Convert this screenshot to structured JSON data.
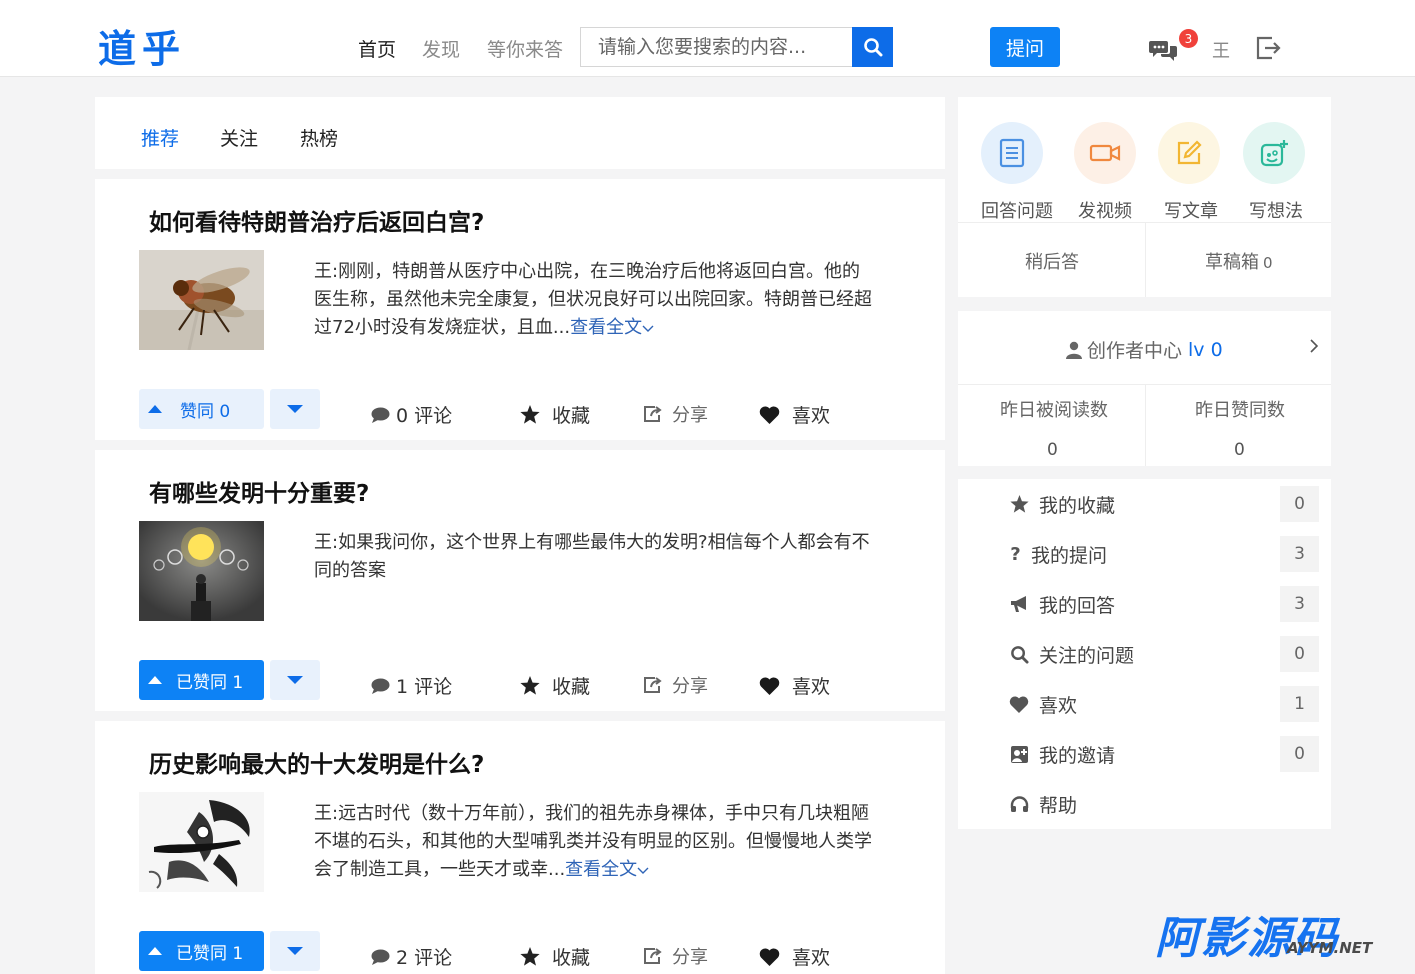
{
  "header": {
    "logo": "道乎",
    "nav": [
      "首页",
      "发现",
      "等你来答"
    ],
    "search_placeholder": "请输入您要搜索的内容...",
    "ask_label": "提问",
    "message_badge": "3",
    "user_name": "王"
  },
  "feed_tabs": [
    "推荐",
    "关注",
    "热榜"
  ],
  "posts": [
    {
      "title": "如何看待特朗普治疗后返回白宫?",
      "excerpt": "王:刚刚，特朗普从医疗中心出院，在三晚治疗后他将返回白宫。他的医生称，虽然他未完全康复，但状况良好可以出院回家。特朗普已经超过72小时没有发烧症状，且血...",
      "more": "查看全文",
      "vote_label": "赞同 0",
      "comments": "0 评论",
      "favorite": "收藏",
      "share": "分享",
      "like": "喜欢"
    },
    {
      "title": "有哪些发明十分重要?",
      "excerpt": "王:如果我问你，这个世界上有哪些最伟大的发明?相信每个人都会有不同的答案",
      "more": "",
      "vote_label": "已赞同 1",
      "comments": "1 评论",
      "favorite": "收藏",
      "share": "分享",
      "like": "喜欢"
    },
    {
      "title": "历史影响最大的十大发明是什么?",
      "excerpt": "王:远古时代（数十万年前），我们的祖先赤身裸体，手中只有几块粗陋不堪的石头，和其他的大型哺乳类并没有明显的区别。但慢慢地人类学会了制造工具，一些天才或幸...",
      "more": "查看全文",
      "vote_label": "已赞同 1",
      "comments": "2 评论",
      "favorite": "收藏",
      "share": "分享",
      "like": "喜欢"
    }
  ],
  "quick_actions": [
    "回答问题",
    "发视频",
    "写文章",
    "写想法"
  ],
  "later_answer": "稍后答",
  "drafts": {
    "label": "草稿箱",
    "count": "0"
  },
  "creator": {
    "title": "创作者中心",
    "level": "lv 0"
  },
  "stats": [
    {
      "label": "昨日被阅读数",
      "value": "0"
    },
    {
      "label": "昨日赞同数",
      "value": "0"
    }
  ],
  "menu": [
    {
      "label": "我的收藏",
      "count": "0",
      "icon": "star-icon"
    },
    {
      "label": "我的提问",
      "count": "3",
      "icon": "question-icon"
    },
    {
      "label": "我的回答",
      "count": "3",
      "icon": "bullhorn-icon"
    },
    {
      "label": "关注的问题",
      "count": "0",
      "icon": "search-icon"
    },
    {
      "label": "喜欢",
      "count": "1",
      "icon": "heart-icon"
    },
    {
      "label": "我的邀请",
      "count": "0",
      "icon": "invite-icon"
    },
    {
      "label": "帮助",
      "count": "",
      "icon": "headphones-icon"
    }
  ],
  "watermark": {
    "main": "阿影源码",
    "sub": "AYYM.NET"
  },
  "colors": {
    "brand": "#0d6ce8",
    "button": "#0d82f5",
    "badge": "#f0413b"
  }
}
